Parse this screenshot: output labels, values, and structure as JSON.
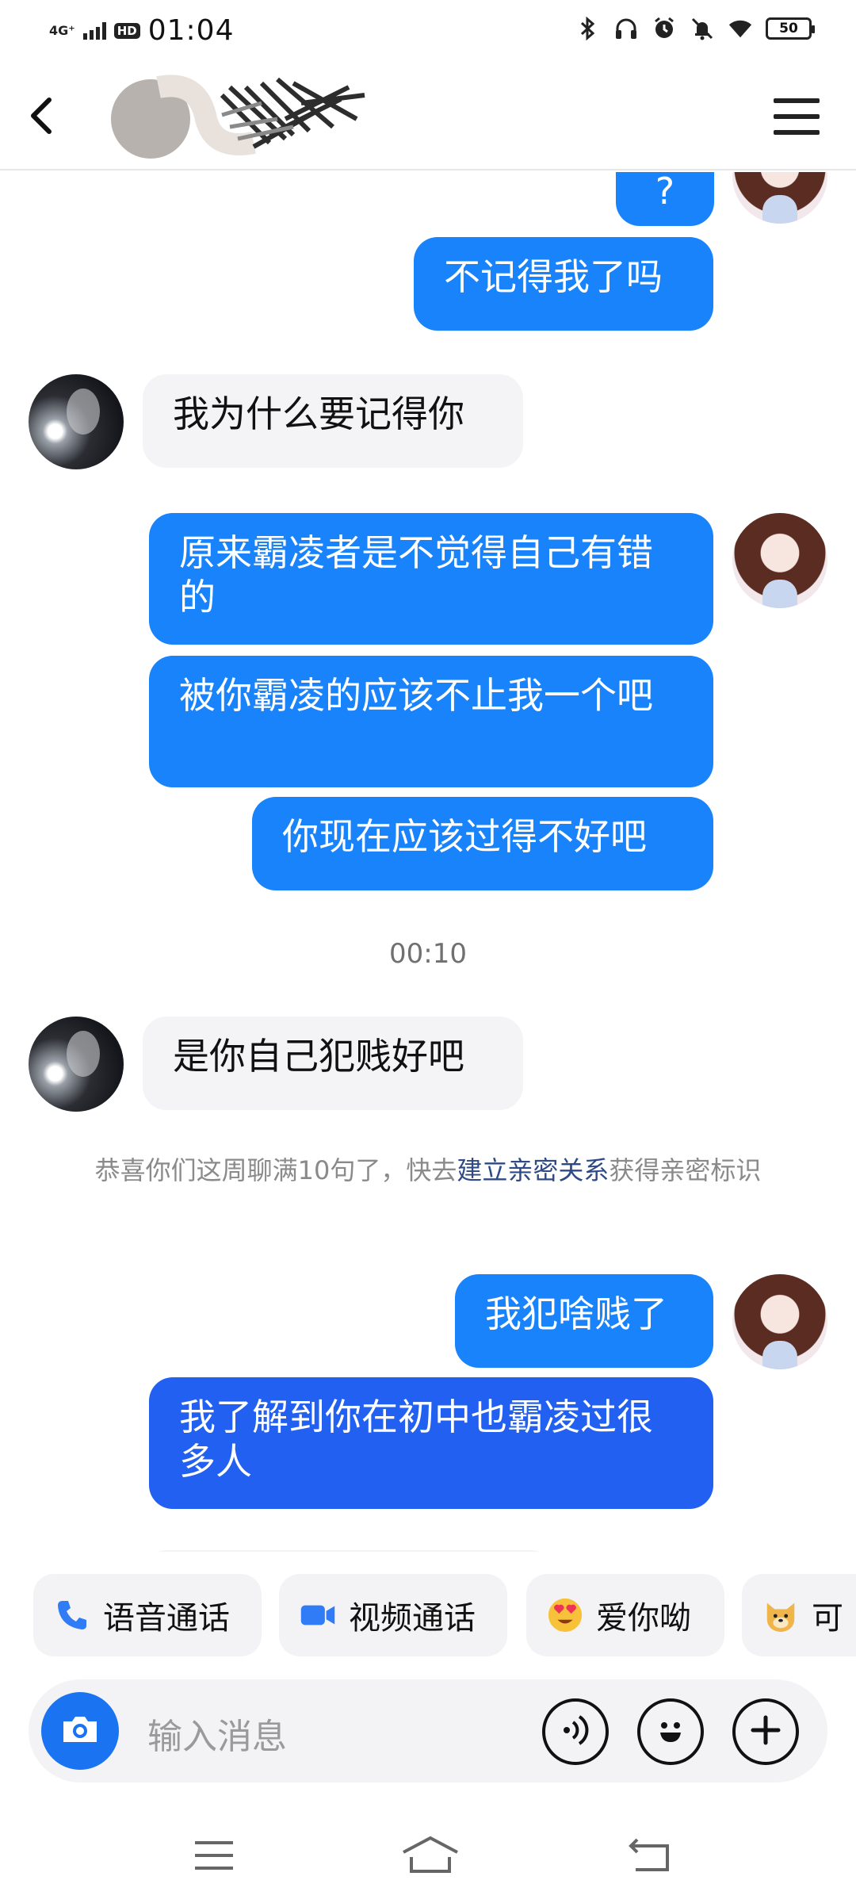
{
  "status_bar": {
    "network": "4G⁺",
    "hd": "HD",
    "time": "01:04",
    "battery": "50"
  },
  "messages": [
    {
      "from": "me",
      "text": "?"
    },
    {
      "from": "me",
      "text": "不记得我了吗"
    },
    {
      "from": "other",
      "text": "我为什么要记得你"
    },
    {
      "from": "me",
      "text": "原来霸凌者是不觉得自己有错的"
    },
    {
      "from": "me",
      "text": "被你霸凌的应该不止我一个吧"
    },
    {
      "from": "me",
      "text": "你现在应该过得不好吧"
    },
    {
      "from": "other",
      "text": "是你自己犯贱好吧"
    },
    {
      "from": "me",
      "text": "我犯啥贱了"
    },
    {
      "from": "me",
      "text": "我了解到你在初中也霸凌过很多人"
    }
  ],
  "timestamp": "00:10",
  "system_notice": {
    "prefix": "恭喜你们这周聊满10句了，快去",
    "link": "建立亲密关系",
    "suffix": "获得亲密标识"
  },
  "quick_actions": [
    {
      "label": "语音通话",
      "icon": "phone-icon"
    },
    {
      "label": "视频通话",
      "icon": "video-camera-icon"
    },
    {
      "label": "爱你呦",
      "icon": "heart-eyes-emoji-icon"
    },
    {
      "label": "可",
      "icon": "doge-emoji-icon"
    }
  ],
  "input": {
    "placeholder": "输入消息"
  },
  "colors": {
    "accent": "#1883fb",
    "bubble_other": "#f4f4f6",
    "link": "#2d4a86"
  }
}
